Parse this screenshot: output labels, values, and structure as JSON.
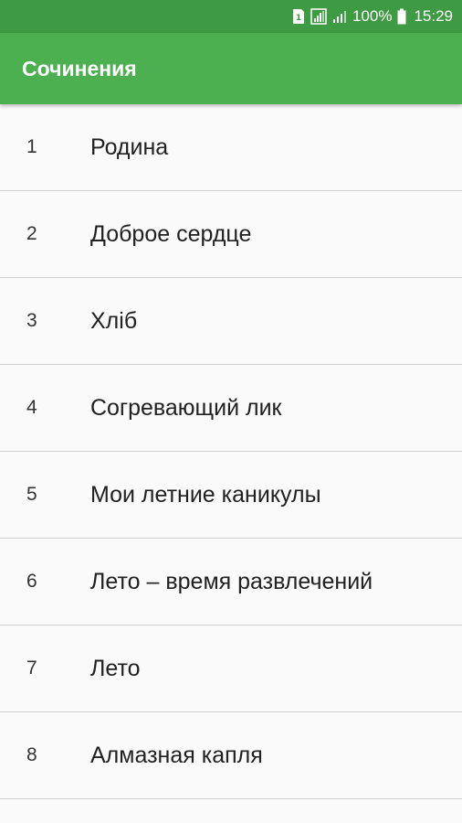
{
  "status_bar": {
    "sim_icon": "sim-card-icon",
    "signal1_icon": "signal-bars-boxed-icon",
    "signal2_icon": "signal-bars-icon",
    "battery_icon": "battery-icon",
    "battery_text": "100%",
    "time": "15:29"
  },
  "app_bar": {
    "title": "Сочинения"
  },
  "list": {
    "items": [
      {
        "number": "1",
        "label": "Родина"
      },
      {
        "number": "2",
        "label": "Доброе сердце"
      },
      {
        "number": "3",
        "label": "Хліб"
      },
      {
        "number": "4",
        "label": "Согревающий лик"
      },
      {
        "number": "5",
        "label": "Мои летние каникулы"
      },
      {
        "number": "6",
        "label": "Лето – время развлечений"
      },
      {
        "number": "7",
        "label": "Лето"
      },
      {
        "number": "8",
        "label": "Алмазная капля"
      }
    ]
  },
  "colors": {
    "status_bar": "#3f9b43",
    "app_bar": "#4caf50",
    "background": "#fafafa",
    "divider": "#d0d0d0"
  }
}
